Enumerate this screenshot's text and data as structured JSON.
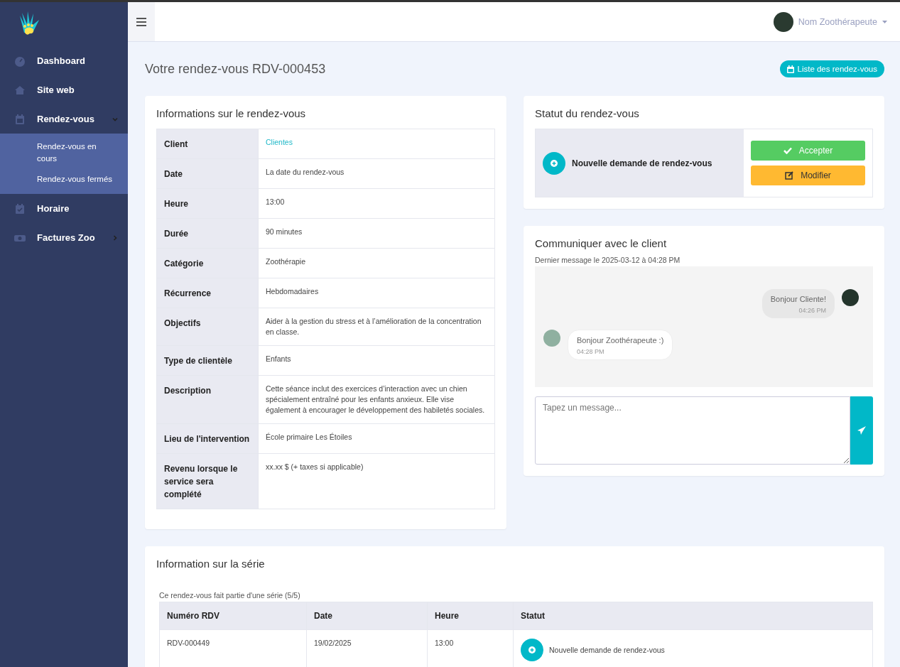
{
  "sidebar": {
    "items": [
      {
        "label": "Dashboard",
        "kind": "link"
      },
      {
        "label": "Site web",
        "kind": "link"
      },
      {
        "label": "Rendez-vous",
        "kind": "group",
        "expanded": true,
        "children": [
          {
            "label": "Rendez-vous en cours"
          },
          {
            "label": "Rendez-vous fermés"
          }
        ]
      },
      {
        "label": "Horaire",
        "kind": "link"
      },
      {
        "label": "Factures Zoo",
        "kind": "group",
        "expanded": false
      }
    ]
  },
  "topbar": {
    "user_name": "Nom Zoothérapeute"
  },
  "page": {
    "title": "Votre rendez-vous RDV-000453",
    "list_button": "Liste des rendez-vous"
  },
  "appointment_info": {
    "title": "Informations sur le rendez-vous",
    "rows": [
      {
        "label": "Client",
        "value": "Clientes",
        "kind": "link"
      },
      {
        "label": "Date",
        "value": "La date du rendez-vous",
        "kind": "text"
      },
      {
        "label": "Heure",
        "value": "13:00",
        "kind": "text"
      },
      {
        "label": "Durée",
        "value": "90 minutes",
        "kind": "text"
      },
      {
        "label": "Catégorie",
        "value": "Zoothérapie",
        "kind": "text"
      },
      {
        "label": "Récurrence",
        "value": "Hebdomadaires",
        "kind": "text"
      },
      {
        "label": "Objectifs",
        "value": "Aider à la gestion du stress et à l’amélioration de la concentration en classe.",
        "kind": "text"
      },
      {
        "label": "Type de clientèle",
        "value": "Enfants",
        "kind": "text"
      },
      {
        "label": "Description",
        "value": "Cette séance inclut des exercices d’interaction avec un chien spécialement entraîné pour les enfants anxieux. Elle vise également à encourager le développement des habiletés sociales.",
        "kind": "text"
      },
      {
        "label": "Lieu de l'intervention",
        "value": "École primaire Les Étoiles",
        "kind": "text"
      },
      {
        "label": "Revenu lorsque le service sera complété",
        "value": "xx.xx $ (+ taxes si applicable)",
        "kind": "text"
      }
    ]
  },
  "status": {
    "title": "Statut du rendez-vous",
    "text": "Nouvelle demande de rendez-vous",
    "buttons": [
      {
        "label": "Accepter",
        "kind": "accept"
      },
      {
        "label": "Modifier",
        "kind": "edit"
      }
    ]
  },
  "chat": {
    "title": "Communiquer avec le client",
    "last_message": "Dernier message le 2025-03-12 à 04:28 PM",
    "messages": [
      {
        "text": "Bonjour Cliente!",
        "time": "04:26 PM",
        "kind": "sent"
      },
      {
        "text": "Bonjour Zoothérapeute :)",
        "time": "04:28 PM",
        "kind": "received"
      }
    ],
    "input": {
      "placeholder": "Tapez un message..."
    }
  },
  "series": {
    "title": "Information sur la série",
    "note": "Ce rendez-vous fait partie d'une série (5/5)",
    "columns": [
      "Numéro RDV",
      "Date",
      "Heure",
      "Statut"
    ],
    "rows": [
      {
        "number": "RDV-000449",
        "date": "19/02/2025",
        "time": "13:00",
        "status": "Nouvelle demande de rendez-vous"
      }
    ]
  }
}
